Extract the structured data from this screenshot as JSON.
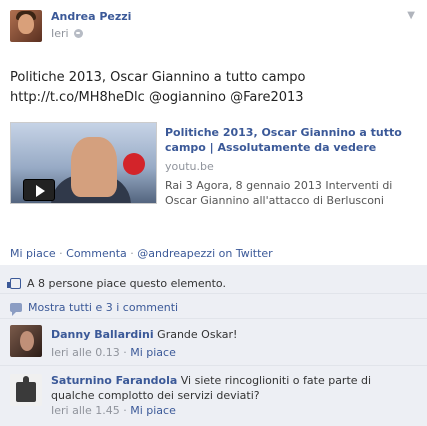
{
  "header": {
    "author": "Andrea Pezzi",
    "time": "Ieri"
  },
  "post": {
    "text_line1": "Politiche 2013, Oscar Giannino a tutto campo",
    "text_line2": "http://t.co/MH8heDlc @ogiannino @Fare2013"
  },
  "link_preview": {
    "title_line1": "Politiche 2013, Oscar Giannino a tutto",
    "title_line2": "campo | Assolutamente da vedere",
    "domain": "youtu.be",
    "desc_line1": "Rai 3 Agora, 8 gennaio 2013 Interventi di",
    "desc_line2": "Oscar Giannino all'attacco di Berlusconi"
  },
  "actions": {
    "like": "Mi piace",
    "dot1": "·",
    "comment": "Commenta",
    "dot2": "·",
    "via": "@andreapezzi on Twitter"
  },
  "likes": {
    "text": "A 8 persone piace questo elemento."
  },
  "view_all": {
    "text": "Mostra tutti e 3 i commenti"
  },
  "comments": [
    {
      "author": "Danny Ballardini",
      "text_line1": " Grande Oskar!",
      "text_line2": "",
      "time": "Ieri alle 0.13",
      "dot": " · ",
      "like": "Mi piace"
    },
    {
      "author": "Saturnino Farandola",
      "text_line1": " Vi siete rincoglioniti o fate parte di",
      "text_line2": "qualche complotto dei servizi deviati?",
      "time": "Ieri alle 1.45",
      "dot": " · ",
      "like": "Mi piace"
    }
  ],
  "colors": {
    "link": "#3b5998",
    "ufi_bg": "#edeff4",
    "muted": "#90949c"
  },
  "icons": [
    "globe-icon",
    "chevron-down-icon",
    "play-icon",
    "thumbs-up-icon",
    "comment-icon"
  ]
}
